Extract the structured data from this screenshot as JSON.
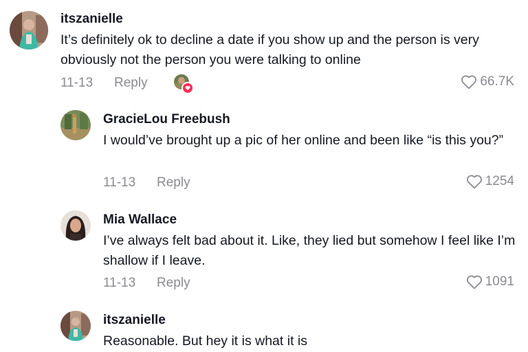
{
  "comments": [
    {
      "username": "itszanielle",
      "text": "It’s definitely ok to decline a date if you show up and the person is very obviously not the person you were talking to online",
      "date": "11-13",
      "reply_label": "Reply",
      "likes": "66.7K",
      "liked_by_creator": true
    },
    {
      "username": "GracieLou Freebush",
      "text": "I would’ve brought up a pic of her online and been like “is this you?”",
      "date": "11-13",
      "reply_label": "Reply",
      "likes": "1254"
    },
    {
      "username": "Mia Wallace",
      "text": "I’ve always felt bad about it. Like, they lied but somehow I feel like I’m shallow if I leave.",
      "date": "11-13",
      "reply_label": "Reply",
      "likes": "1091"
    },
    {
      "username": "itszanielle",
      "text": "Reasonable. But hey it is what it is"
    }
  ],
  "icons": {
    "like": "heart-outline-icon",
    "creator_like": "creator-liked-badge-icon"
  },
  "colors": {
    "text": "#161823",
    "muted": "#8a8b91",
    "creator_heart": "#fe2c55"
  }
}
